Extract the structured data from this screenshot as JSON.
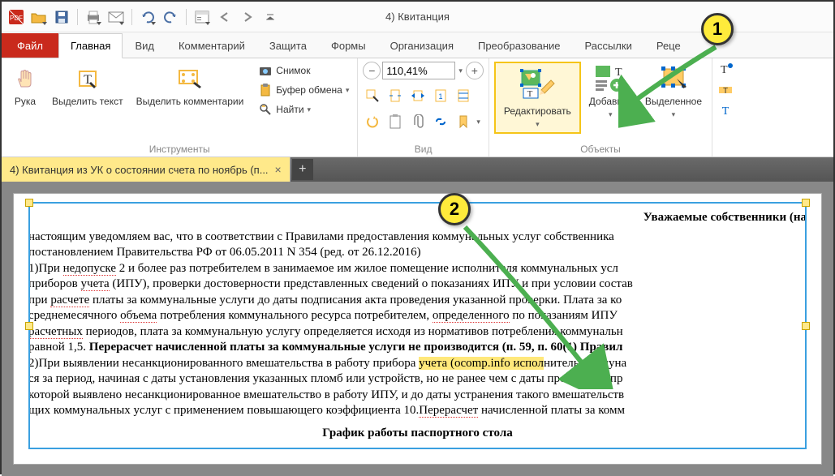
{
  "app_title": "4) Квитанция",
  "file_tab": "Файл",
  "tabs": [
    "Главная",
    "Вид",
    "Комментарий",
    "Защита",
    "Формы",
    "Организация",
    "Преобразование",
    "Рассылки",
    "Реце"
  ],
  "active_tab_index": 0,
  "tools": {
    "hand": "Рука",
    "select_text": "Выделить текст",
    "select_comments": "Выделить комментарии",
    "snapshot": "Снимок",
    "clipboard": "Буфер обмена",
    "find": "Найти",
    "group_instruments": "Инструменты"
  },
  "view": {
    "zoom": "110,41%",
    "group": "Вид"
  },
  "objects": {
    "edit": "Редактировать",
    "add": "Добавить",
    "selected": "Выделенное",
    "group": "Объекты"
  },
  "doc_tab": "4) Квитанция из УК о состоянии счета по ноябрь (п...",
  "doc": {
    "heading": "Уважаемые собственники (на",
    "p1a": "настоящим уведомляем вас, что в соответствии с Правилами предоставления коммунальных услуг собственника",
    "p1b": "постановлением Правительства РФ от 06.05.2011 N 354 (ред. от 26.12.2016)",
    "p2a": "1)При ",
    "p2_ned": "недопуске",
    "p2b": " 2 и более раз потребителем в занимаемое им жилое помещение исполнителя коммунальных усл",
    "p3a": "приборов ",
    "p3_uch": "учета",
    "p3b": " (ИПУ), проверки достоверности представленных сведений о показаниях ИПУ и при условии состав",
    "p4a": "при ",
    "p4_ras": "расчете",
    "p4b": " платы за коммунальные услуги до даты подписания акта проведения указанной проверки. Плата за ко",
    "p5a": "среднемесячного ",
    "p5_ob": "объема",
    "p5b": " потребления коммунального ресурса потребителем, ",
    "p5_op": "определенного",
    "p5c": " по показаниям ИПУ ",
    "p6_ras": "расчетных",
    "p6a": " периодов, плата за коммунальную услугу определяется исходя из нормативов потребления коммунальн",
    "p7a": "равной 1,5. ",
    "p7_bold": "Перерасчет начисленной платы за коммунальные услуги не производится (п. 59, п. 60(1) Правил",
    "p8a": "2)При выявлении несанкционированного вмешательства в работу прибора ",
    "p8_hl1": "учета (ocomp.info испол",
    "p8b": "нитель коммуна",
    "p9": "ся за период, начиная с даты установления указанных пломб или устройств, но не ранее чем с даты проведения пр",
    "p10": "которой выявлено несанкционированное вмешательство в работу ИПУ, и до даты устранения такого вмешательств",
    "p11a": "щих коммунальных услуг с применением повышающего коэффициента 10.",
    "p11_per": "Перерасчет",
    "p11b": " начисленной платы за комм",
    "footer": "График работы паспортного стола"
  },
  "callouts": {
    "one": "1",
    "two": "2"
  }
}
